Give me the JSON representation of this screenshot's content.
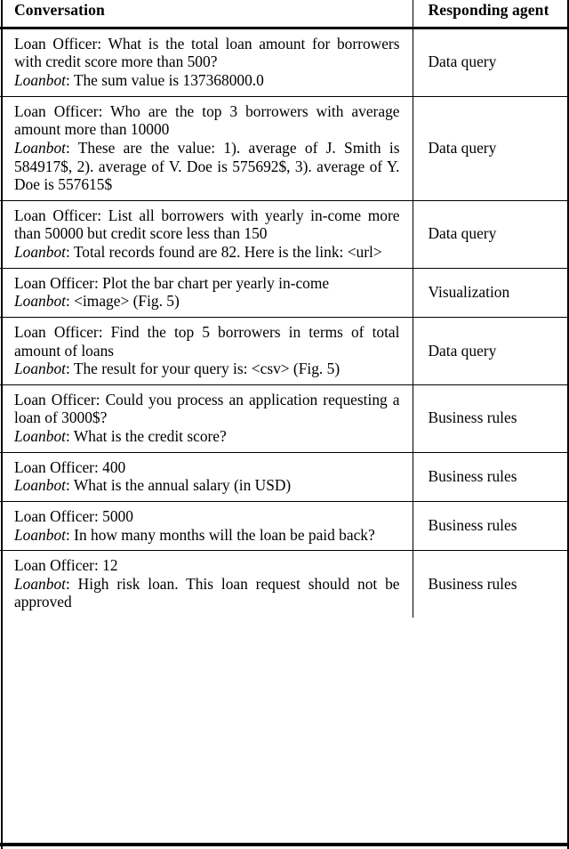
{
  "table": {
    "columns": [
      {
        "key": "conversation",
        "header": "Conversation"
      },
      {
        "key": "responding_agent",
        "header": "Responding agent"
      }
    ],
    "rows": [
      {
        "officer_label": "Loan Officer:",
        "officer_text": " What is the total loan amount for borrowers with credit score more than 500?",
        "bot_label": "Loanbot",
        "bot_text": ": The sum value is 137368000.0",
        "responding_agent": "Data query"
      },
      {
        "officer_label": "Loan Officer:",
        "officer_text": " Who are the top 3 borrowers with average amount more than 10000",
        "bot_label": "Loanbot",
        "bot_text": ": These are the value: 1). average of J. Smith is 584917$, 2). average of V. Doe is 575692$, 3). average of Y. Doe is 557615$",
        "responding_agent": "Data query"
      },
      {
        "officer_label": "Loan Officer:",
        "officer_text": " List all borrowers with yearly in-come more than 50000 but credit score less than 150",
        "bot_label": "Loanbot",
        "bot_text": ": Total records found are 82. Here is the link: <url>",
        "responding_agent": "Data query"
      },
      {
        "officer_label": "Loan Officer:",
        "officer_text": " Plot the bar chart per yearly in-come",
        "bot_label": "Loanbot",
        "bot_text": ": <image> (Fig. 5)",
        "responding_agent": "Visualization"
      },
      {
        "officer_label": "Loan Officer:",
        "officer_text": " Find the top 5 borrowers in terms of total amount of loans",
        "bot_label": "Loanbot",
        "bot_text": ": The result for your query is: <csv> (Fig. 5)",
        "responding_agent": "Data query"
      },
      {
        "officer_label": "Loan Officer:",
        "officer_text": " Could you process an application requesting a loan of 3000$?",
        "bot_label": "Loanbot",
        "bot_text": ": What is the credit score?",
        "responding_agent": "Business rules"
      },
      {
        "officer_label": "Loan Officer:",
        "officer_text": " 400",
        "bot_label": "Loanbot",
        "bot_text": ": What is the annual salary (in USD)",
        "responding_agent": "Business rules"
      },
      {
        "officer_label": "Loan Officer:",
        "officer_text": " 5000",
        "bot_label": "Loanbot",
        "bot_text": ": In how many months will the loan be paid back?",
        "responding_agent": "Business rules"
      },
      {
        "officer_label": "Loan Officer:",
        "officer_text": " 12",
        "bot_label": "Loanbot",
        "bot_text": ": High risk loan. This loan request should not be approved",
        "responding_agent": "Business rules"
      }
    ]
  },
  "style": {
    "rule_color": "#000000",
    "text_color": "#000000",
    "background": "#ffffff"
  }
}
